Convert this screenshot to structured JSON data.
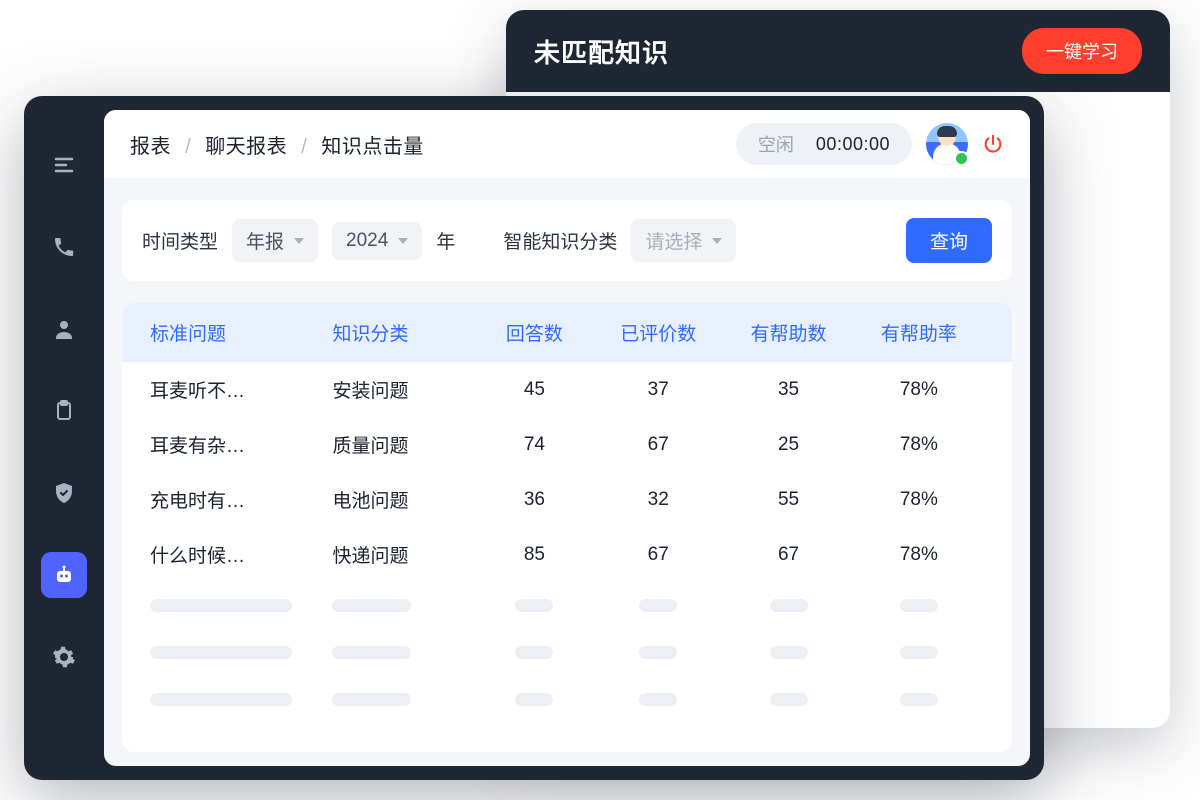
{
  "back": {
    "title": "未匹配知识",
    "learn_btn": "一键学习"
  },
  "breadcrumb": {
    "a": "报表",
    "b": "聊天报表",
    "c": "知识点击量"
  },
  "status": {
    "label": "空闲",
    "time": "00:00:00"
  },
  "filters": {
    "time_type_label": "时间类型",
    "time_type_value": "年报",
    "year_value": "2024",
    "year_suffix": "年",
    "category_label": "智能知识分类",
    "category_placeholder": "请选择",
    "query_btn": "查询"
  },
  "table": {
    "headers": {
      "question": "标准问题",
      "category": "知识分类",
      "answers": "回答数",
      "rated": "已评价数",
      "helpful": "有帮助数",
      "rate": "有帮助率"
    },
    "rows": [
      {
        "question": "耳麦听不…",
        "category": "安装问题",
        "answers": "45",
        "rated": "37",
        "helpful": "35",
        "rate": "78%"
      },
      {
        "question": "耳麦有杂…",
        "category": "质量问题",
        "answers": "74",
        "rated": "67",
        "helpful": "25",
        "rate": "78%"
      },
      {
        "question": "充电时有…",
        "category": "电池问题",
        "answers": "36",
        "rated": "32",
        "helpful": "55",
        "rate": "78%"
      },
      {
        "question": "什么时候…",
        "category": "快递问题",
        "answers": "85",
        "rated": "67",
        "helpful": "67",
        "rate": "78%"
      }
    ]
  }
}
